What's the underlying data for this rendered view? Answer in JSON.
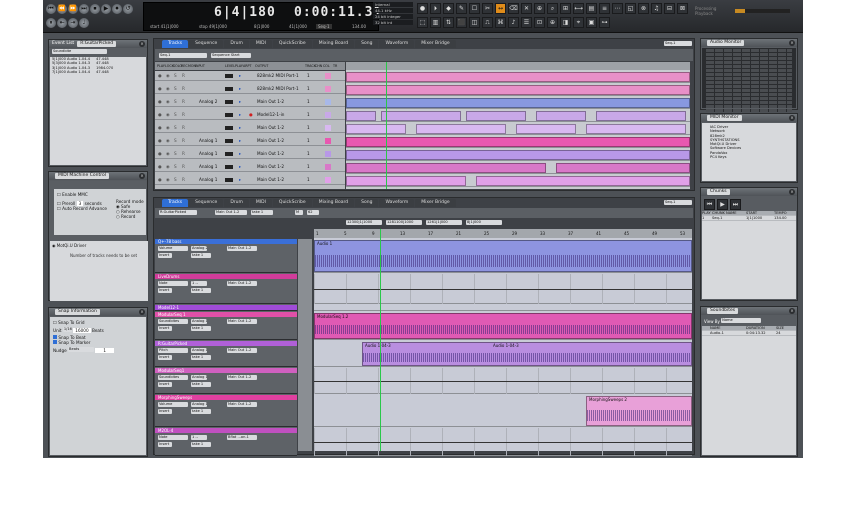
{
  "transport": {
    "buttons": [
      "⏮",
      "⏪",
      "⏩",
      "⏭",
      "⏹",
      "▶",
      "⏺",
      "↺",
      "⏸",
      "⇤",
      "⇥",
      "♩"
    ],
    "bars_display": "6|4|180",
    "time_display": "0:00:11.31",
    "start_label": "start",
    "start_value": "41|1|000",
    "stop_label": "stop",
    "stop_value": "49|1|000",
    "len_value": "8|1|000",
    "out_value": "41|1|000",
    "seq_label": "Seq-1",
    "tempo": "134.00",
    "sync": [
      "Internal",
      "44.1 kHz",
      "24 bit integer",
      "32 bit int"
    ],
    "perf_label": "Processing",
    "perf_label2": "Playback",
    "perf_value": 0.18,
    "tools": [
      "●",
      "⏵",
      "◆",
      "✎",
      "☐",
      "✂",
      "↔",
      "⌫",
      "✕",
      "⊕",
      "⌕",
      "⊞",
      "⟷",
      "▤",
      "≡",
      "⋯",
      "◱",
      "⊗",
      "♫",
      "⊟",
      "⊠",
      "⬚",
      "▥",
      "⇅",
      "⬛",
      "◫",
      "⎍",
      "⌘",
      "♪",
      "☰",
      "⊡",
      "⊕",
      "◨",
      "⌖",
      "▣",
      "⊶"
    ]
  },
  "event_list": {
    "title": "Event List",
    "source": "R:GuitarPicked",
    "mode": "Soundbite",
    "rows": [
      [
        "5|1|000 Audio 1-04-4",
        "47.448"
      ],
      [
        "5|3|000 Audio 1-04-3",
        "47.448"
      ],
      [
        "3|1|000 Audio 1-04-3",
        "1984.070"
      ],
      [
        "7|1|000 Audio 1-04-4",
        "47.448"
      ]
    ]
  },
  "midi_machine": {
    "title": "MIDI Machine Control",
    "enable": "Enable MMC",
    "preroll": "Preroll",
    "preroll_val": "3",
    "seconds": "seconds",
    "auto_advance": "Auto Record Advance",
    "record_mode": "Record mode",
    "opt_safe": "Safe",
    "opt_rehearse": "Rehearse",
    "opt_record": "Record",
    "driver": "MotQi.U Driver",
    "msg": "Number of tracks needs to be set"
  },
  "snap": {
    "title": "Snap Information",
    "snap_grid": "Snap To Grid",
    "unit": "Unit",
    "unit_val": "1/16",
    "beat_val": "16000",
    "beats": "Beats",
    "snap_beat": "Snap To Beat",
    "snap_marker": "Snap To Marker",
    "nudge": "Nudge",
    "nudge_unit": "Beats",
    "nudge_val": "1"
  },
  "upper": {
    "tabs": [
      "Tracks",
      "Sequence",
      "Drum",
      "MIDI",
      "QuickScribe",
      "Mixing Board",
      "Song",
      "Waveform",
      "Mixer Bridge"
    ],
    "seq": "Seq-1",
    "seq_name": "Seq-1",
    "seq_start": "Sequence Start",
    "cols": [
      "PLAY",
      "LOCK",
      "SOLO",
      "REC",
      "MON",
      "INPUT",
      "LEVEL",
      "PLAY",
      "ARPT",
      "OUTPUT",
      "TRACK",
      "CHN",
      "COL",
      "TR"
    ],
    "tracks": [
      {
        "input": "",
        "output": "828mk2 MIDI Port-1",
        "n": "1",
        "color": "#e890c8"
      },
      {
        "input": "",
        "output": "828mk2 MIDI Port-1",
        "n": "1",
        "color": "#e890c8"
      },
      {
        "input": "Analog 2",
        "output": "Main Out 1-2",
        "n": "1",
        "color": "#a8b8e8"
      },
      {
        "input": "",
        "output": "Model12-1-in",
        "n": "1",
        "color": "#c8a8e8"
      },
      {
        "input": "",
        "output": "Main Out 1-2",
        "n": "1",
        "color": "#d8b8f0"
      },
      {
        "input": "Analog 1",
        "output": "Main Out 1-2",
        "n": "1",
        "color": "#e858b0"
      },
      {
        "input": "Analog 1",
        "output": "Main Out 1-2",
        "n": "1",
        "color": "#b898e8"
      },
      {
        "input": "Analog 1",
        "output": "Main Out 1-2",
        "n": "1",
        "color": "#d878c8"
      },
      {
        "input": "Analog 1",
        "output": "Main Out 1-2",
        "n": "1",
        "color": "#e0a0e8"
      }
    ]
  },
  "lower": {
    "tabs": [
      "Tracks",
      "Sequence",
      "Drum",
      "MIDI",
      "QuickScribe",
      "Mixing Board",
      "Song",
      "Waveform",
      "Mixer Bridge"
    ],
    "seq": "Seq-1",
    "head_track": "R:GuitarPicked",
    "head_out": "Main Out 1-2",
    "head_take": "take 1",
    "m": "M",
    "counter": "62",
    "pos": [
      "12300|1|1000",
      "1281100|1000",
      "1261|1|000",
      "8|1|000"
    ],
    "ruler": [
      "1",
      "5",
      "9",
      "13",
      "17",
      "21",
      "25",
      "29",
      "33",
      "37",
      "41",
      "45",
      "49",
      "53"
    ],
    "tracks": [
      {
        "name": "Q+-78 bass",
        "color": "#3a6fd8",
        "ctl": "Volume",
        "in": "Analog 2",
        "out": "Main Out 1-2",
        "mode": "Insert",
        "take": "take 1",
        "clip": "Audio 1",
        "clip_color": "#8e94e0",
        "h": 34
      },
      {
        "name": "LiveDrums",
        "color": "#d03c9a",
        "ctl": "Note",
        "in": "1 --",
        "out": "Main Out 1-2",
        "mode": "Insert",
        "take": "take 1",
        "clip": "",
        "clip_color": "#c8cbd6",
        "h": 30
      },
      {
        "name": "Model12-1",
        "color": "#a04cd8",
        "ctl": "",
        "in": "",
        "out": "",
        "mode": "",
        "take": "",
        "clip": "",
        "clip_color": "#c8cbd6",
        "h": 6
      },
      {
        "name": "ModularSeq 1",
        "color": "#e050a8",
        "ctl": "Soundbites",
        "in": "Analog 1",
        "out": "Main Out 1-2",
        "mode": "Insert",
        "take": "take 1",
        "clip": "ModularSeq 1.2",
        "clip_color": "#e05ab4",
        "h": 28
      },
      {
        "name": "R:GuitarPicked",
        "color": "#b060d8",
        "ctl": "Pitch",
        "in": "Analog 1",
        "out": "Main Out 1-2",
        "mode": "Insert",
        "take": "take 1",
        "clip": "Audio 1-04-3",
        "clip_color": "#b98ee0",
        "h": 26
      },
      {
        "name": "ModularSeq1",
        "color": "#d060c0",
        "ctl": "Soundbites",
        "in": "Analog 1",
        "out": "Main Out 1-2",
        "mode": "Insert",
        "take": "take 1",
        "clip": "",
        "clip_color": "#c8cbd6",
        "h": 26
      },
      {
        "name": "MorphingSweeps",
        "color": "#e040a0",
        "ctl": "Volume",
        "in": "Analog 1",
        "out": "Main Out 1-2",
        "mode": "Insert",
        "take": "take 1",
        "clip": "MorphingSweeps 2",
        "clip_color": "#e8a0d8",
        "h": 32
      },
      {
        "name": "M2OL-4",
        "color": "#c050c0",
        "ctl": "Note",
        "in": "1 --",
        "out": "Bflat ...on-1",
        "mode": "Insert",
        "take": "take 1",
        "clip": "",
        "clip_color": "#c8cbd6",
        "h": 28
      }
    ],
    "clip2": "Audio 1-04-3"
  },
  "audio_monitor": {
    "title": "Audio Monitor"
  },
  "midi_monitor": {
    "title": "MIDI Monitor",
    "items": [
      "IAC Driver",
      "Network",
      "828mk2",
      "SYNTHSTATIONS",
      "MotQi.U Driver",
      "Software Devices",
      "PandaVox",
      "PC4 Keys"
    ]
  },
  "chunks": {
    "title": "Chunks",
    "cols": [
      "PLAY",
      "CHUNK NAME",
      "START",
      "TEMPO"
    ],
    "row": [
      "1",
      "Seq-1",
      "1|1|1000",
      "134.00"
    ]
  },
  "soundbites": {
    "title": "Soundbites",
    "view_by": "View By",
    "view_val": "Name",
    "cols": [
      "NAME",
      "DURATION",
      "SIZE"
    ],
    "rows": [
      [
        "Audio-1",
        "0:04:13.32",
        "24"
      ],
      [
        "Audio-1-02",
        "0:01:12.47",
        "24"
      ],
      [
        "Audio-1-02",
        "0:01:12.47",
        "24"
      ],
      [
        "Audio-1-02-2",
        "0:01:12.57",
        "24"
      ],
      [
        "Audio-1-02-3",
        "0:01:12.47",
        "24"
      ],
      [
        "Audio-1-02-4",
        "0:01:12.47",
        "24"
      ],
      [
        "Audio-1-02-5",
        "0:01:12.47",
        "24"
      ],
      [
        "Audio-1-02-6",
        "0:01:12.47",
        "24"
      ],
      [
        "Audio-1-02-7",
        "0:01:12.47",
        "24"
      ],
      [
        "Audio-1-02-8",
        "0:01:12.47",
        "24"
      ],
      [
        "Audio-1-02-9",
        "0:01:12.47",
        "24"
      ],
      [
        "Audio-1-04",
        "0:01:36.74",
        "24"
      ],
      [
        "Audio-1-04-2",
        "0:01:26.74",
        "24"
      ],
      [
        "Audio-1-04-3",
        "0:01:24.74",
        "24"
      ],
      [
        "Audio-1-04-4",
        "0:01:23.74",
        "24"
      ],
      [
        "Audio-4",
        "0:00:07.74",
        "24"
      ],
      [
        "Audio-4-10",
        "0:00:07.74",
        "24"
      ],
      [
        "Audio-4-11",
        "0:00:07.74",
        "24"
      ],
      [
        "Audio-4-12",
        "0:00:07.74",
        "24"
      ],
      [
        "Audio-4-13",
        "0:00:07.74",
        "24"
      ],
      [
        "Audio-4-14",
        "0:00:07.74",
        "24"
      ],
      [
        "Audio-4-15",
        "0:00:07.74",
        "24"
      ],
      [
        "Audio-4-16",
        "0:00:07.74",
        "24"
      ],
      [
        "Audio-4-17",
        "0:00:07.74",
        "24"
      ]
    ]
  }
}
